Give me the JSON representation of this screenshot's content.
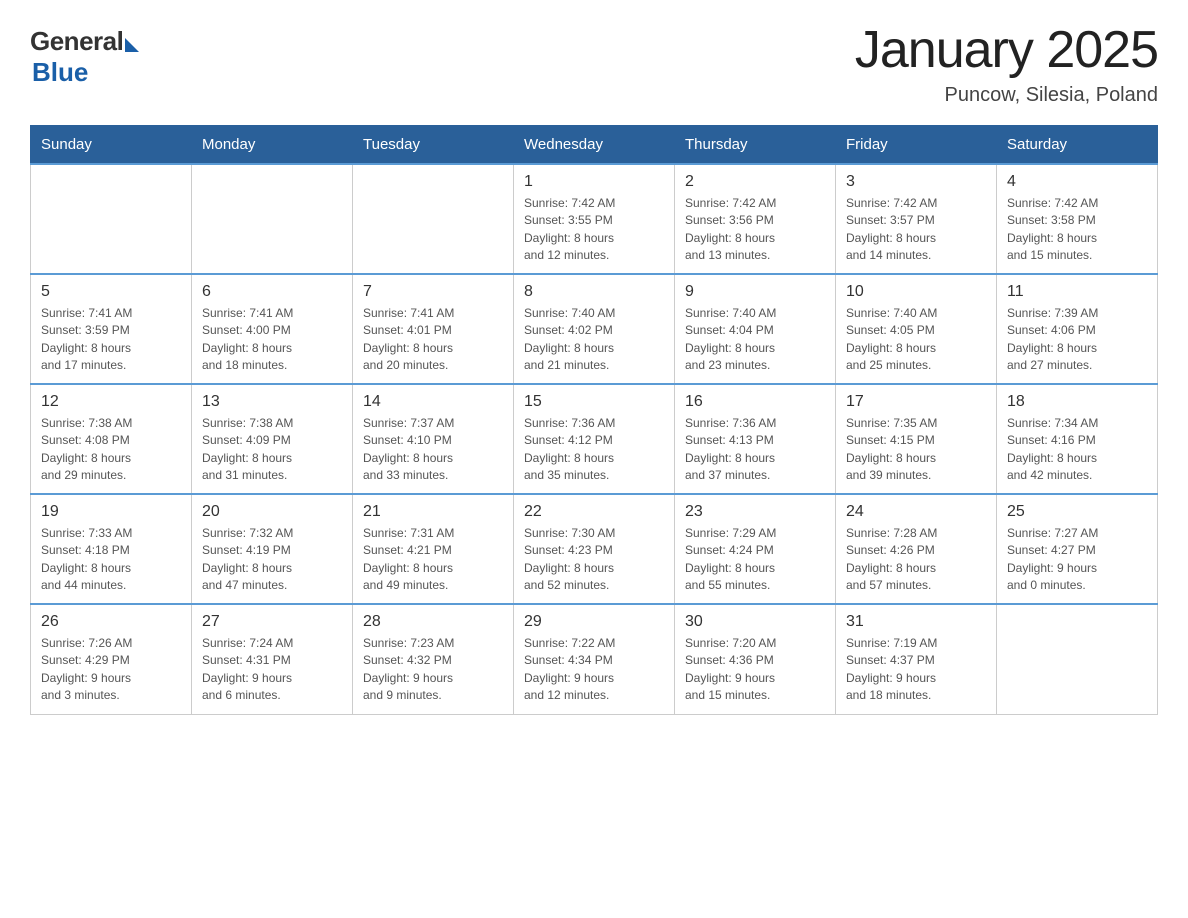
{
  "logo": {
    "general": "General",
    "blue": "Blue"
  },
  "title": "January 2025",
  "subtitle": "Puncow, Silesia, Poland",
  "days_of_week": [
    "Sunday",
    "Monday",
    "Tuesday",
    "Wednesday",
    "Thursday",
    "Friday",
    "Saturday"
  ],
  "weeks": [
    [
      {
        "day": "",
        "info": ""
      },
      {
        "day": "",
        "info": ""
      },
      {
        "day": "",
        "info": ""
      },
      {
        "day": "1",
        "info": "Sunrise: 7:42 AM\nSunset: 3:55 PM\nDaylight: 8 hours\nand 12 minutes."
      },
      {
        "day": "2",
        "info": "Sunrise: 7:42 AM\nSunset: 3:56 PM\nDaylight: 8 hours\nand 13 minutes."
      },
      {
        "day": "3",
        "info": "Sunrise: 7:42 AM\nSunset: 3:57 PM\nDaylight: 8 hours\nand 14 minutes."
      },
      {
        "day": "4",
        "info": "Sunrise: 7:42 AM\nSunset: 3:58 PM\nDaylight: 8 hours\nand 15 minutes."
      }
    ],
    [
      {
        "day": "5",
        "info": "Sunrise: 7:41 AM\nSunset: 3:59 PM\nDaylight: 8 hours\nand 17 minutes."
      },
      {
        "day": "6",
        "info": "Sunrise: 7:41 AM\nSunset: 4:00 PM\nDaylight: 8 hours\nand 18 minutes."
      },
      {
        "day": "7",
        "info": "Sunrise: 7:41 AM\nSunset: 4:01 PM\nDaylight: 8 hours\nand 20 minutes."
      },
      {
        "day": "8",
        "info": "Sunrise: 7:40 AM\nSunset: 4:02 PM\nDaylight: 8 hours\nand 21 minutes."
      },
      {
        "day": "9",
        "info": "Sunrise: 7:40 AM\nSunset: 4:04 PM\nDaylight: 8 hours\nand 23 minutes."
      },
      {
        "day": "10",
        "info": "Sunrise: 7:40 AM\nSunset: 4:05 PM\nDaylight: 8 hours\nand 25 minutes."
      },
      {
        "day": "11",
        "info": "Sunrise: 7:39 AM\nSunset: 4:06 PM\nDaylight: 8 hours\nand 27 minutes."
      }
    ],
    [
      {
        "day": "12",
        "info": "Sunrise: 7:38 AM\nSunset: 4:08 PM\nDaylight: 8 hours\nand 29 minutes."
      },
      {
        "day": "13",
        "info": "Sunrise: 7:38 AM\nSunset: 4:09 PM\nDaylight: 8 hours\nand 31 minutes."
      },
      {
        "day": "14",
        "info": "Sunrise: 7:37 AM\nSunset: 4:10 PM\nDaylight: 8 hours\nand 33 minutes."
      },
      {
        "day": "15",
        "info": "Sunrise: 7:36 AM\nSunset: 4:12 PM\nDaylight: 8 hours\nand 35 minutes."
      },
      {
        "day": "16",
        "info": "Sunrise: 7:36 AM\nSunset: 4:13 PM\nDaylight: 8 hours\nand 37 minutes."
      },
      {
        "day": "17",
        "info": "Sunrise: 7:35 AM\nSunset: 4:15 PM\nDaylight: 8 hours\nand 39 minutes."
      },
      {
        "day": "18",
        "info": "Sunrise: 7:34 AM\nSunset: 4:16 PM\nDaylight: 8 hours\nand 42 minutes."
      }
    ],
    [
      {
        "day": "19",
        "info": "Sunrise: 7:33 AM\nSunset: 4:18 PM\nDaylight: 8 hours\nand 44 minutes."
      },
      {
        "day": "20",
        "info": "Sunrise: 7:32 AM\nSunset: 4:19 PM\nDaylight: 8 hours\nand 47 minutes."
      },
      {
        "day": "21",
        "info": "Sunrise: 7:31 AM\nSunset: 4:21 PM\nDaylight: 8 hours\nand 49 minutes."
      },
      {
        "day": "22",
        "info": "Sunrise: 7:30 AM\nSunset: 4:23 PM\nDaylight: 8 hours\nand 52 minutes."
      },
      {
        "day": "23",
        "info": "Sunrise: 7:29 AM\nSunset: 4:24 PM\nDaylight: 8 hours\nand 55 minutes."
      },
      {
        "day": "24",
        "info": "Sunrise: 7:28 AM\nSunset: 4:26 PM\nDaylight: 8 hours\nand 57 minutes."
      },
      {
        "day": "25",
        "info": "Sunrise: 7:27 AM\nSunset: 4:27 PM\nDaylight: 9 hours\nand 0 minutes."
      }
    ],
    [
      {
        "day": "26",
        "info": "Sunrise: 7:26 AM\nSunset: 4:29 PM\nDaylight: 9 hours\nand 3 minutes."
      },
      {
        "day": "27",
        "info": "Sunrise: 7:24 AM\nSunset: 4:31 PM\nDaylight: 9 hours\nand 6 minutes."
      },
      {
        "day": "28",
        "info": "Sunrise: 7:23 AM\nSunset: 4:32 PM\nDaylight: 9 hours\nand 9 minutes."
      },
      {
        "day": "29",
        "info": "Sunrise: 7:22 AM\nSunset: 4:34 PM\nDaylight: 9 hours\nand 12 minutes."
      },
      {
        "day": "30",
        "info": "Sunrise: 7:20 AM\nSunset: 4:36 PM\nDaylight: 9 hours\nand 15 minutes."
      },
      {
        "day": "31",
        "info": "Sunrise: 7:19 AM\nSunset: 4:37 PM\nDaylight: 9 hours\nand 18 minutes."
      },
      {
        "day": "",
        "info": ""
      }
    ]
  ]
}
